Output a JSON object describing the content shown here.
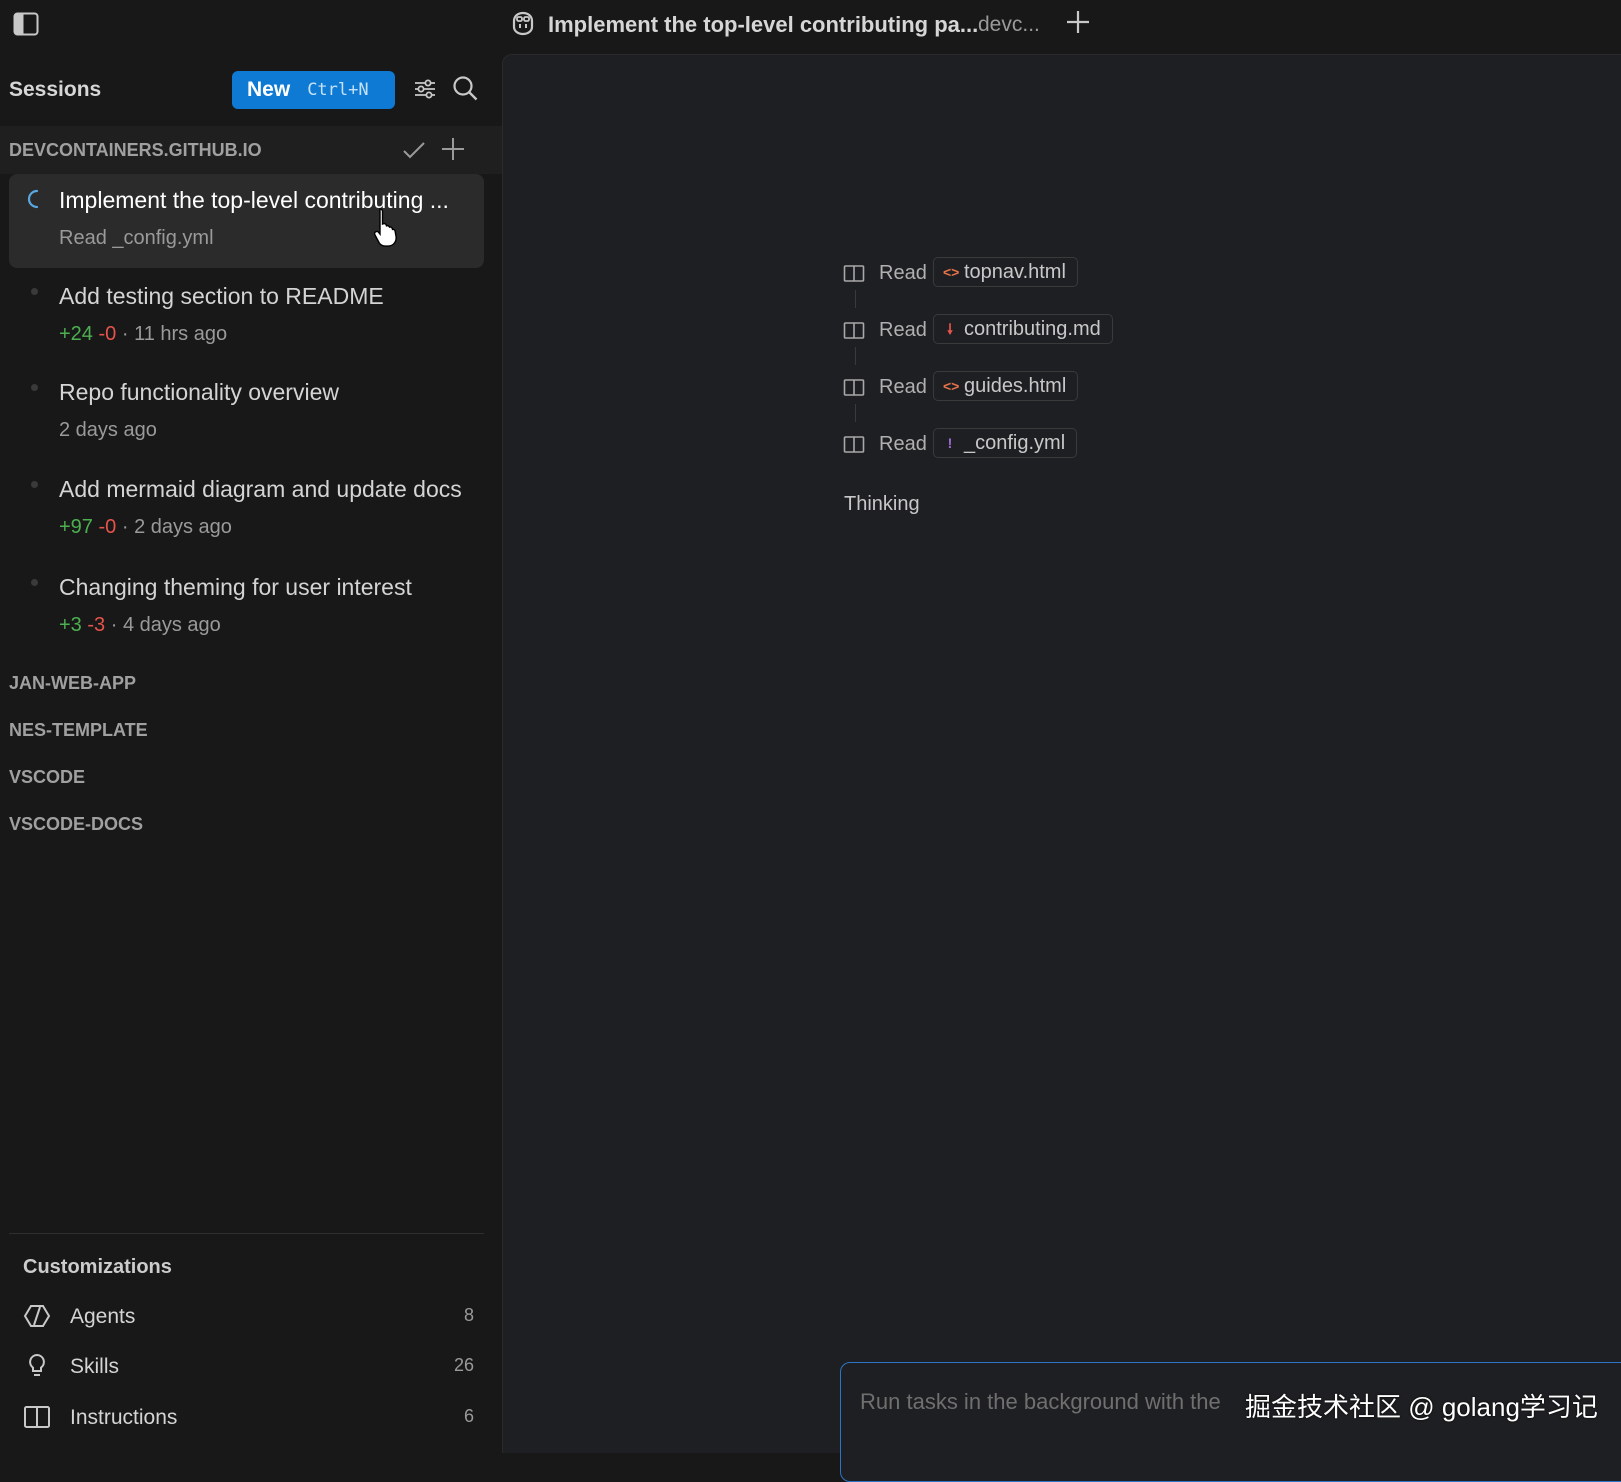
{
  "topbar": {
    "session_title": "Implement the top-level contributing pa...",
    "session_repo": "devc..."
  },
  "sidebar": {
    "sessions_label": "Sessions",
    "new_button_label": "New",
    "new_button_shortcut": "Ctrl+N",
    "repo_header": "DEVCONTAINERS.GITHUB.IO",
    "sessions": [
      {
        "title": "Implement the top-level contributing ...",
        "status": "Read _config.yml",
        "active": true
      },
      {
        "title": "Add testing section to README",
        "added": "+24",
        "removed": "-0",
        "time": "· 11 hrs ago"
      },
      {
        "title": "Repo functionality overview",
        "time": "2 days ago"
      },
      {
        "title": "Add mermaid diagram and update docs",
        "added": "+97",
        "removed": "-0",
        "time": "· 2 days ago"
      },
      {
        "title": "Changing theming for user interest",
        "added": "+3",
        "removed": "-3",
        "time": "· 4 days ago"
      }
    ],
    "groups": [
      "JAN-WEB-APP",
      "NES-TEMPLATE",
      "VSCODE",
      "VSCODE-DOCS"
    ],
    "customizations": {
      "title": "Customizations",
      "items": [
        {
          "label": "Agents",
          "count": "8"
        },
        {
          "label": "Skills",
          "count": "26"
        },
        {
          "label": "Instructions",
          "count": "6"
        }
      ]
    }
  },
  "main": {
    "tool_calls": [
      {
        "verb": "Read",
        "file": "topnav.html",
        "file_icon": "html-file-icon",
        "icon_glyph": "<>",
        "icon_color": "#e8734a"
      },
      {
        "verb": "Read",
        "file": "contributing.md",
        "file_icon": "markdown-file-icon",
        "icon_glyph": "🠗",
        "icon_color": "#e5534b"
      },
      {
        "verb": "Read",
        "file": "guides.html",
        "file_icon": "html-file-icon",
        "icon_glyph": "<>",
        "icon_color": "#e8734a"
      },
      {
        "verb": "Read",
        "file": "_config.yml",
        "file_icon": "yaml-file-icon",
        "icon_glyph": "!",
        "icon_color": "#a06cd5"
      }
    ],
    "thinking_label": "Thinking",
    "input_placeholder": "Run tasks in the background with the",
    "watermark": "掘金技术社区 @ golang学习记"
  },
  "colors": {
    "accent": "#0e7ad4",
    "diff_added": "#4caf50",
    "diff_removed": "#e5534b",
    "input_border": "#2d74c4"
  }
}
